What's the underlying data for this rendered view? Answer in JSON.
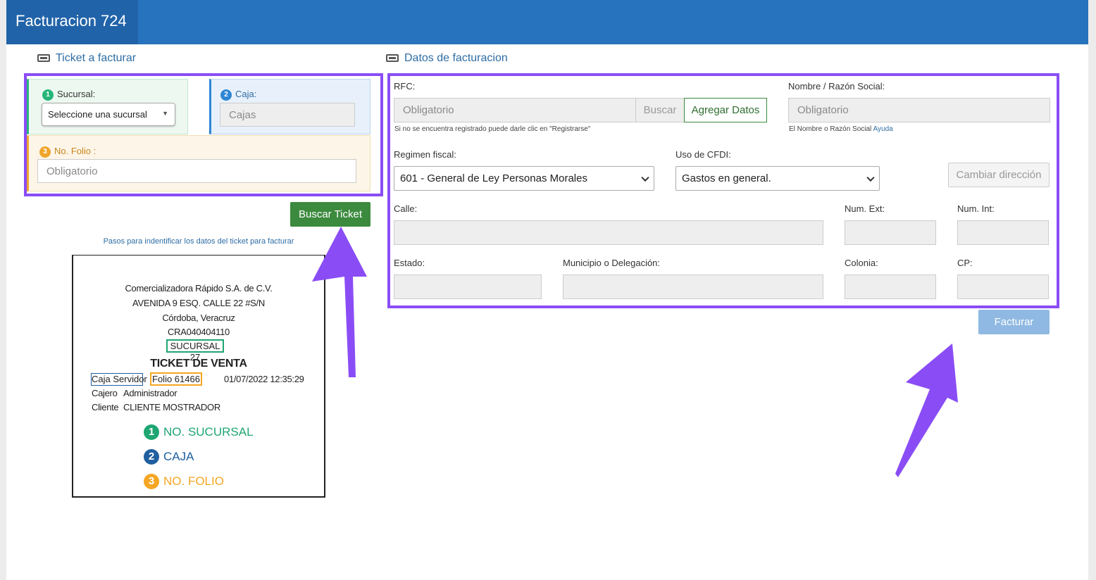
{
  "app": {
    "title": "Facturacion 724"
  },
  "colors": {
    "header": "#2873bd",
    "brand": "#2163a9",
    "accent_green": "#3c8a3e",
    "highlight": "#8a4df5",
    "step1": "#27b57a",
    "step2": "#2f86d4",
    "step3": "#f0a52b"
  },
  "ticket_section": {
    "title": "Ticket a facturar",
    "icon": "ticket-icon",
    "sucursal": {
      "step": "1",
      "label": "Sucursal:",
      "selected": "Seleccione una sucursal"
    },
    "caja": {
      "step": "2",
      "label": "Caja:",
      "placeholder": "Cajas"
    },
    "folio": {
      "step": "3",
      "label": "No. Folio :",
      "placeholder": "Obligatorio"
    },
    "search_button": "Buscar Ticket",
    "help_link": "Pasos para indentificar los datos del ticket para facturar"
  },
  "ticket_example": {
    "company": "Comercializadora Rápido S.A. de C.V.",
    "address": "AVENIDA 9 ESQ. CALLE 22 #S/N",
    "city": "Córdoba, Veracruz",
    "rfc": "CRA040404110",
    "sucursal": "SUCURSAL 27",
    "heading": "TICKET DE VENTA",
    "caja": "Caja Servidor",
    "folio": "Folio 61466",
    "datetime": "01/07/2022 12:35:29",
    "cajero_label": "Cajero",
    "cajero_value": "Administrador",
    "cliente_label": "Cliente",
    "cliente_value": "CLIENTE MOSTRADOR",
    "legend": [
      {
        "num": "1",
        "text": "NO. SUCURSAL",
        "color": "#1ea672"
      },
      {
        "num": "2",
        "text": "CAJA",
        "color": "#1f5fa0"
      },
      {
        "num": "3",
        "text": "NO. FOLIO",
        "color": "#f5a623"
      }
    ]
  },
  "billing_section": {
    "title": "Datos de facturacion",
    "icon": "ticket-icon",
    "rfc": {
      "label": "RFC:",
      "placeholder": "Obligatorio",
      "search_button": "Buscar",
      "add_button": "Agregar Datos",
      "help": "Si no se encuentra registrado puede darle clic en \"Registrarse\""
    },
    "nombre": {
      "label": "Nombre / Razón Social:",
      "placeholder": "Obligatorio",
      "help": "El Nombre o Razón Social",
      "help_link": "Ayuda"
    },
    "regimen": {
      "label": "Regimen fiscal:",
      "selected": "601 - General de Ley Personas Morales"
    },
    "uso_cfdi": {
      "label": "Uso de CFDI:",
      "selected": "Gastos en general."
    },
    "change_address_button": "Cambiar dirección",
    "calle": {
      "label": "Calle:"
    },
    "num_ext": {
      "label": "Num. Ext:"
    },
    "num_int": {
      "label": "Num. Int:"
    },
    "estado": {
      "label": "Estado:"
    },
    "municipio": {
      "label": "Municipio o Delegación:"
    },
    "colonia": {
      "label": "Colonia:"
    },
    "cp": {
      "label": "CP:"
    },
    "submit_button": "Facturar"
  }
}
